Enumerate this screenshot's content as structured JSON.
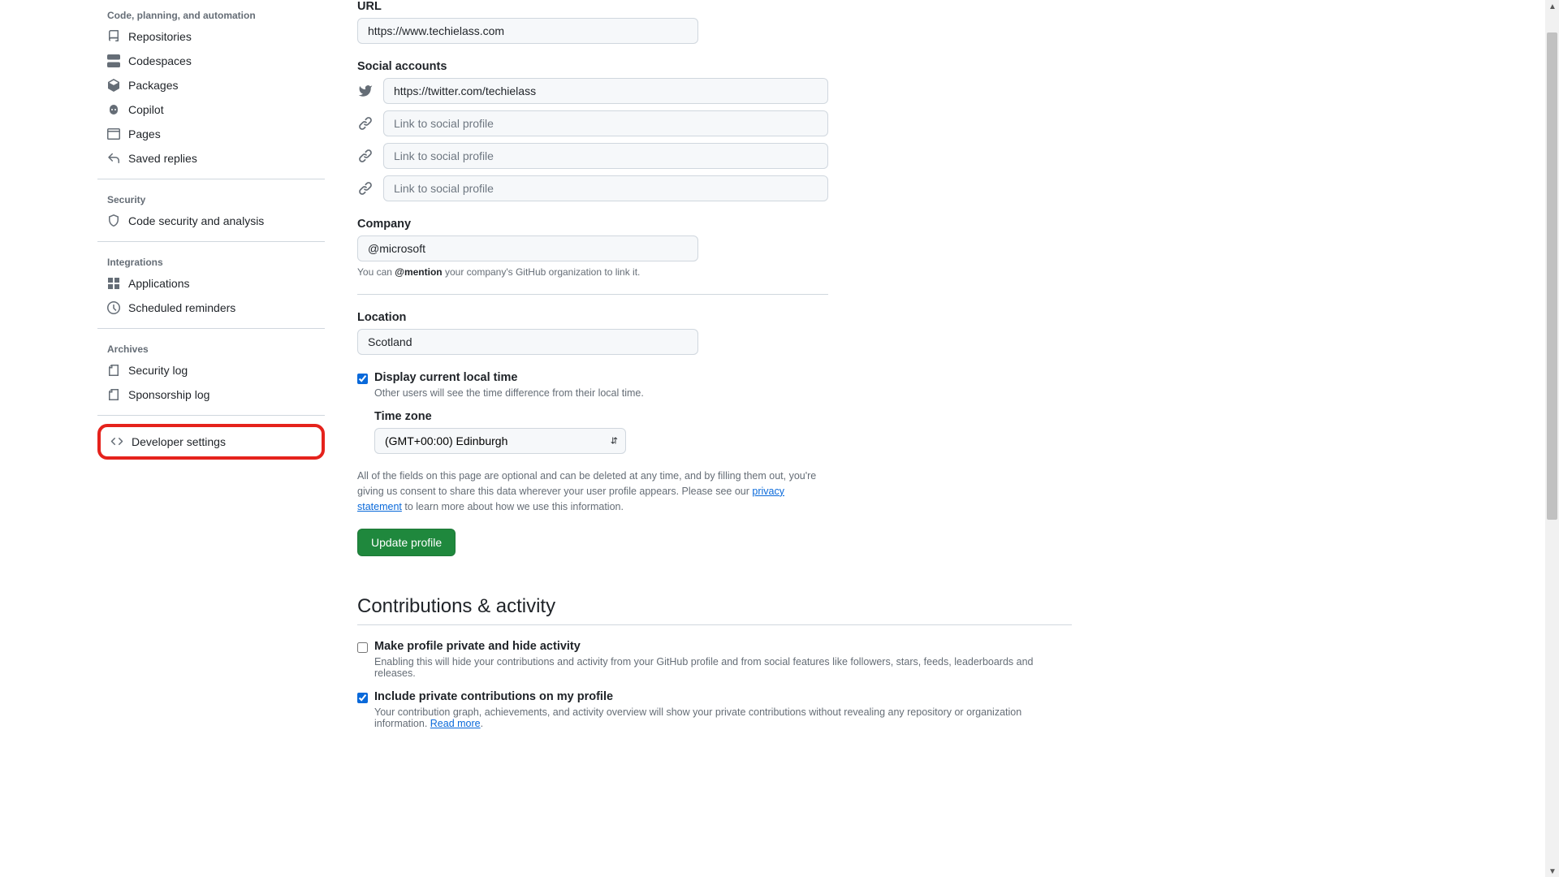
{
  "sidebar": {
    "sections": [
      {
        "title": "Code, planning, and automation",
        "items": [
          {
            "label": "Repositories"
          },
          {
            "label": "Codespaces"
          },
          {
            "label": "Packages"
          },
          {
            "label": "Copilot"
          },
          {
            "label": "Pages"
          },
          {
            "label": "Saved replies"
          }
        ]
      },
      {
        "title": "Security",
        "items": [
          {
            "label": "Code security and analysis"
          }
        ]
      },
      {
        "title": "Integrations",
        "items": [
          {
            "label": "Applications"
          },
          {
            "label": "Scheduled reminders"
          }
        ]
      },
      {
        "title": "Archives",
        "items": [
          {
            "label": "Security log"
          },
          {
            "label": "Sponsorship log"
          }
        ]
      }
    ],
    "developer_settings": "Developer settings"
  },
  "form": {
    "url_label": "URL",
    "url_value": "https://www.techielass.com",
    "social_label": "Social accounts",
    "social_1_value": "https://twitter.com/techielass",
    "social_placeholder": "Link to social profile",
    "company_label": "Company",
    "company_value": "@microsoft",
    "company_help_pre": "You can ",
    "company_help_mention": "@mention",
    "company_help_post": " your company's GitHub organization to link it.",
    "location_label": "Location",
    "location_value": "Scotland",
    "localtime_label": "Display current local time",
    "localtime_help": "Other users will see the time difference from their local time.",
    "tz_label": "Time zone",
    "tz_value": "(GMT+00:00) Edinburgh",
    "privacy_pre": "All of the fields on this page are optional and can be deleted at any time, and by filling them out, you're giving us consent to share this data wherever your user profile appears. Please see our ",
    "privacy_link": "privacy statement",
    "privacy_post": " to learn more about how we use this information.",
    "update_btn": "Update profile"
  },
  "contrib": {
    "title": "Contributions & activity",
    "private_profile_label": "Make profile private and hide activity",
    "private_profile_desc": "Enabling this will hide your contributions and activity from your GitHub profile and from social features like followers, stars, feeds, leaderboards and releases.",
    "include_private_label": "Include private contributions on my profile",
    "include_private_desc_pre": "Your contribution graph, achievements, and activity overview will show your private contributions without revealing any repository or organization information. ",
    "include_private_readmore": "Read more"
  }
}
